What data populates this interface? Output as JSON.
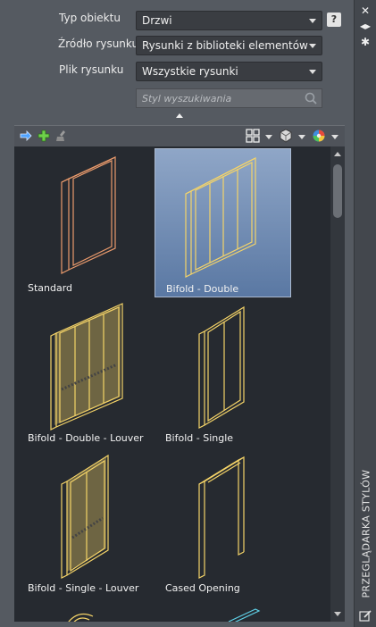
{
  "filters": {
    "object_type": {
      "label": "Typ obiektu",
      "value": "Drzwi"
    },
    "drawing_source": {
      "label": "Źródło rysunku",
      "value": "Rysunki z biblioteki elementów"
    },
    "drawing_file": {
      "label": "Plik rysunku",
      "value": "Wszystkie rysunki"
    },
    "search": {
      "placeholder": "Styl wyszukiwania"
    }
  },
  "help": {
    "label": "?"
  },
  "toolbar": {
    "icons": [
      "arrow-right-icon",
      "add-icon",
      "purge-icon",
      "view-grid-icon",
      "display-mode-icon",
      "color-wheel-icon"
    ]
  },
  "styles": [
    {
      "name": "Standard",
      "selected": false
    },
    {
      "name": "Bifold - Double",
      "selected": true
    },
    {
      "name": "Bifold - Double - Louver",
      "selected": false
    },
    {
      "name": "Bifold - Single",
      "selected": false
    },
    {
      "name": "Bifold - Single - Louver",
      "selected": false
    },
    {
      "name": "Cased Opening",
      "selected": false
    }
  ],
  "side_title": "PRZEGLĄDARKA STYLÓW",
  "colors": {
    "door_line": "#f5d468",
    "door_standard": "#e99a6c",
    "selection": "#6f8bb5"
  }
}
